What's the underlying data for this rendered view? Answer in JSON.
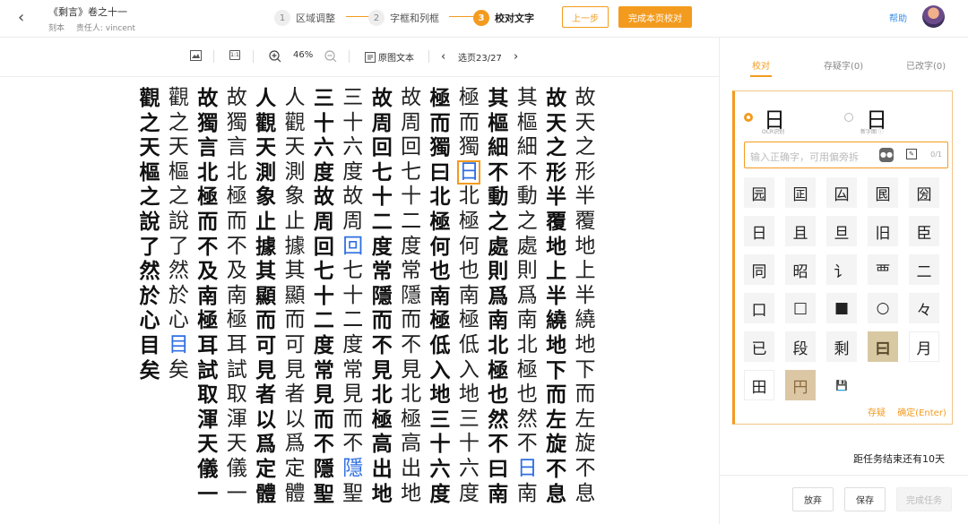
{
  "header": {
    "title": "《剩言》卷之十一",
    "edition": "刻本",
    "owner": "责任人: vincent",
    "steps": [
      {
        "num": "1",
        "label": "区域调整"
      },
      {
        "num": "2",
        "label": "字框和列框"
      },
      {
        "num": "3",
        "label": "校对文字"
      }
    ],
    "prev_button": "上一步",
    "finish_button": "完成本页校对",
    "help": "帮助"
  },
  "toolbar": {
    "zoom": "46%",
    "original_text": "原图文本",
    "page": "选页23/27",
    "ratio_label": "1:1"
  },
  "scan": {
    "columns": [
      {
        "bold": false,
        "chars": "故天之形半覆地上半繞地下而左旋不息"
      },
      {
        "bold": true,
        "chars": "故天之形半覆地上半繞地下而左旋不息"
      },
      {
        "bold": false,
        "chars": "其樞細不動之處則爲南北極也然不日南"
      },
      {
        "bold": true,
        "chars": "其樞細不動之處則爲南北極也然不曰南"
      },
      {
        "bold": false,
        "chars": "極而獨日北極何也南極低入地三十六度"
      },
      {
        "bold": true,
        "chars": "極而獨曰北極何也南極低入地三十六度"
      },
      {
        "bold": false,
        "chars": "故周回七十二度常隱而不見北極高出地"
      },
      {
        "bold": true,
        "chars": "故周回七十二度常隱而不見北極高出地"
      },
      {
        "bold": false,
        "chars": "三十六度故周回七十二度常見而不隱聖"
      },
      {
        "bold": true,
        "chars": "三十六度故周回七十二度常見而不隱聖"
      },
      {
        "bold": false,
        "chars": "人觀天測象止據其顯而可見者以爲定體"
      },
      {
        "bold": true,
        "chars": "人觀天測象止據其顯而可見者以爲定體"
      },
      {
        "bold": false,
        "chars": "故獨言北極而不及南極耳試取渾天儀一"
      },
      {
        "bold": true,
        "chars": "故獨言北極而不及南極耳試取渾天儀一"
      },
      {
        "bold": false,
        "chars": "觀之天樞之說了然於心目矣"
      },
      {
        "bold": true,
        "chars": "觀之天樞之說了然於心目矣"
      }
    ],
    "highlights": {
      "blue": [
        "2:15",
        "8:6",
        "8:15",
        "14:10"
      ],
      "boxed": "4:3"
    }
  },
  "right": {
    "tabs": [
      "校对",
      "存疑字(0)",
      "已改字(0)"
    ],
    "ocr_char": "日",
    "ocr_label": "OCR识别",
    "new_char": "日",
    "new_label": "新字图 ⓘ",
    "input_placeholder": "输入正确字，可用偏旁拆",
    "counter": "0/1",
    "candidates": [
      "园",
      "囸",
      "囜",
      "囻",
      "圀",
      "日",
      "且",
      "旦",
      "旧",
      "臣",
      "同",
      "昭",
      "讠",
      "覀",
      "二",
      "口",
      "□",
      "■",
      "○",
      "々",
      "已",
      "段",
      "剩",
      "曰",
      "月",
      "田",
      "円",
      "💾"
    ],
    "doubt": "存疑",
    "confirm": "确定(Enter)"
  },
  "footer": {
    "deadline": "距任务结束还有10天",
    "abandon": "放弃",
    "save": "保存",
    "complete": "完成任务"
  },
  "colors": {
    "accent": "#f39b1e",
    "link": "#3a8ee6",
    "highlight": "#2f6fe3"
  }
}
